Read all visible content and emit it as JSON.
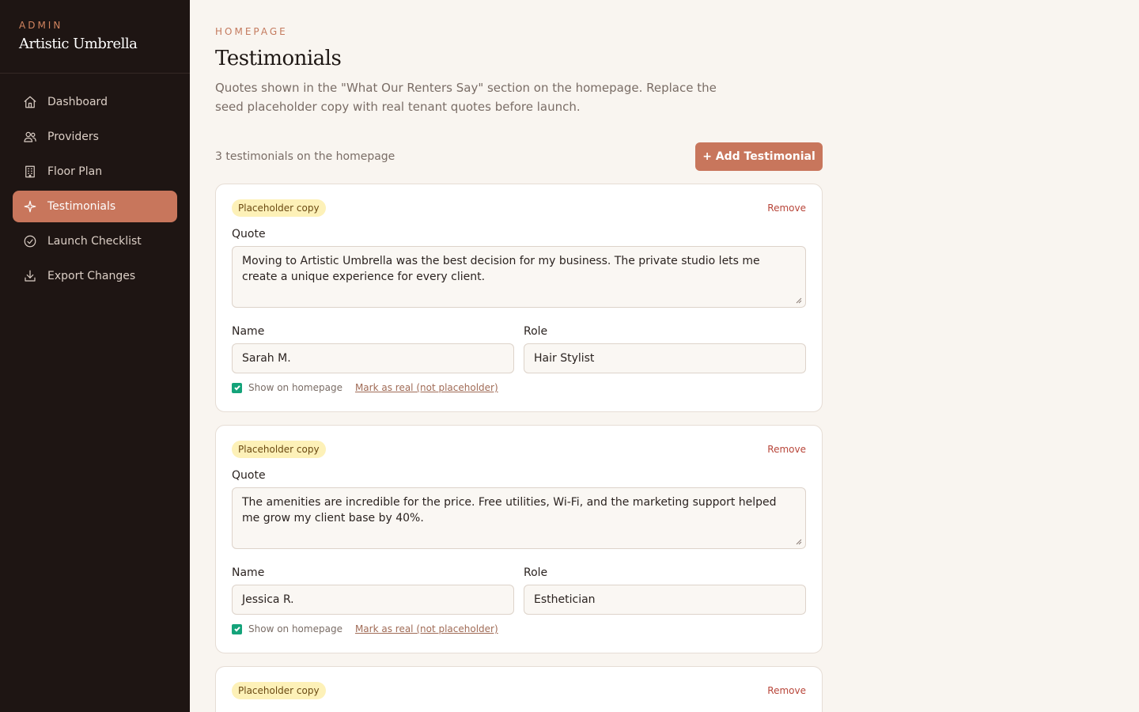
{
  "sidebar": {
    "kicker": "ADMIN",
    "brand": "Artistic Umbrella",
    "items": [
      {
        "label": "Dashboard",
        "icon": "home-icon",
        "active": false
      },
      {
        "label": "Providers",
        "icon": "users-icon",
        "active": false
      },
      {
        "label": "Floor Plan",
        "icon": "building-icon",
        "active": false
      },
      {
        "label": "Testimonials",
        "icon": "sparkle-icon",
        "active": true
      },
      {
        "label": "Launch Checklist",
        "icon": "check-circle-icon",
        "active": false
      },
      {
        "label": "Export Changes",
        "icon": "download-icon",
        "active": false
      }
    ]
  },
  "header": {
    "kicker": "HOMEPAGE",
    "title": "Testimonials",
    "description": "Quotes shown in the \"What Our Renters Say\" section on the homepage. Replace the seed placeholder copy with real tenant quotes before launch."
  },
  "toolbar": {
    "count_text": "3 testimonials on the homepage",
    "add_label": "+ Add Testimonial"
  },
  "labels": {
    "quote": "Quote",
    "name": "Name",
    "role": "Role",
    "show_on_homepage": "Show on homepage",
    "mark_real": "Mark as real (not placeholder)",
    "remove": "Remove",
    "badge": "Placeholder copy"
  },
  "testimonials": [
    {
      "quote": "Moving to Artistic Umbrella was the best decision for my business. The private studio lets me create a unique experience for every client.",
      "name": "Sarah M.",
      "role": "Hair Stylist",
      "show_on_homepage": true
    },
    {
      "quote": "The amenities are incredible for the price. Free utilities, Wi-Fi, and the marketing support helped me grow my client base by 40%.",
      "name": "Jessica R.",
      "role": "Esthetician",
      "show_on_homepage": true
    },
    {
      "quote": "",
      "name": "",
      "role": "",
      "show_on_homepage": true
    }
  ],
  "colors": {
    "sidebar_bg": "#1e1513",
    "accent": "#c8765c",
    "badge_bg": "#fdf1b8",
    "remove": "#b8463a",
    "checkbox": "#14a37a"
  }
}
